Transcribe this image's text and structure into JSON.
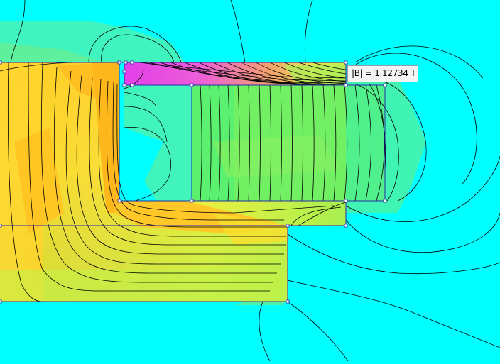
{
  "field_readout": {
    "label": "|B| = 1.12734 T"
  },
  "colors": {
    "background": "#00ffff",
    "low_field": "#40f7b0",
    "mid_field": "#7ff060",
    "high_field": "#ffd21a",
    "peak_field": "#e040e0",
    "flux_line": "#000000",
    "geometry_line": "#2a2aa8"
  },
  "icons": {
    "node_marker": "small-square"
  }
}
